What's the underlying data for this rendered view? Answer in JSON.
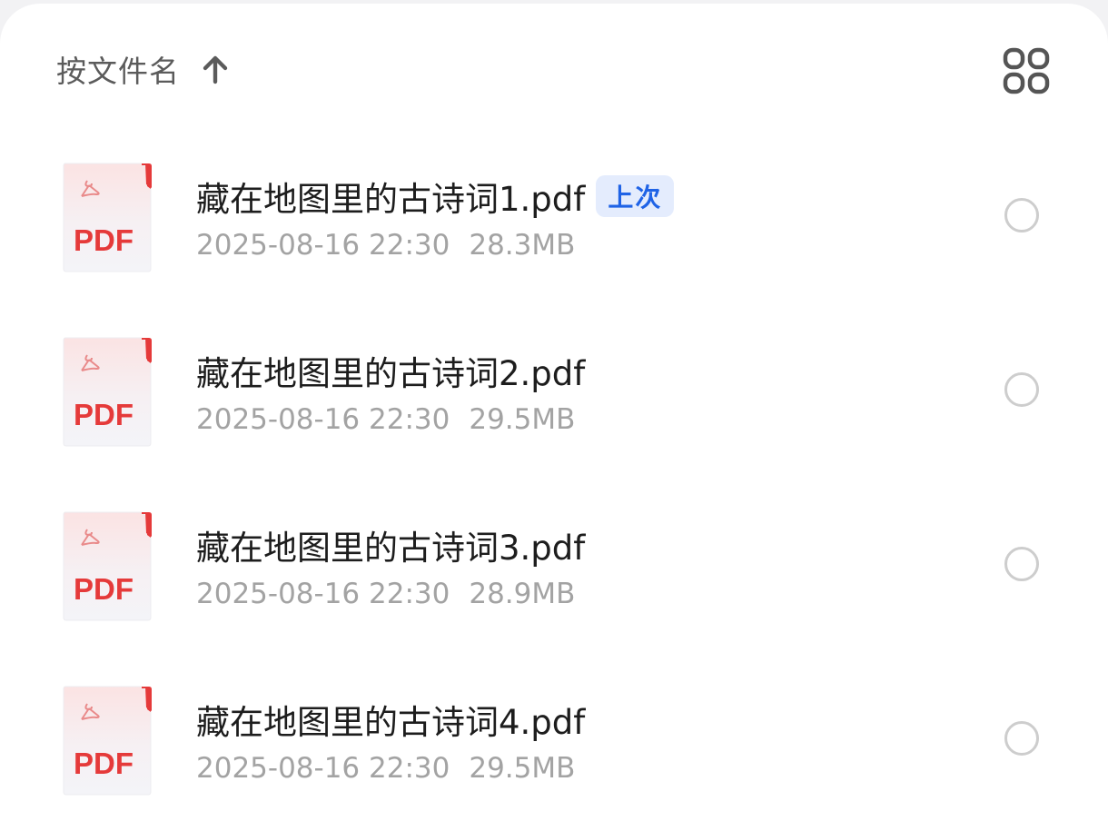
{
  "toolbar": {
    "sort_label": "按文件名",
    "sort_direction_icon": "arrow-up-icon",
    "view_toggle_icon": "grid-view-icon"
  },
  "file_icon": {
    "label": "PDF",
    "icon": "pdf-file-icon",
    "accent_color": "#e53a3a"
  },
  "files": [
    {
      "name": "藏在地图里的古诗词1.pdf",
      "badge": "上次",
      "date": "2025-08-16 22:30",
      "size": "28.3MB",
      "selected": false
    },
    {
      "name": "藏在地图里的古诗词2.pdf",
      "badge": "",
      "date": "2025-08-16 22:30",
      "size": "29.5MB",
      "selected": false
    },
    {
      "name": "藏在地图里的古诗词3.pdf",
      "badge": "",
      "date": "2025-08-16 22:30",
      "size": "28.9MB",
      "selected": false
    },
    {
      "name": "藏在地图里的古诗词4.pdf",
      "badge": "",
      "date": "2025-08-16 22:30",
      "size": "29.5MB",
      "selected": false
    }
  ],
  "colors": {
    "badge_bg": "#e4ecfd",
    "badge_text": "#1f63e6",
    "meta_text": "#a3a3a3",
    "radio_border": "#cdcdcd"
  }
}
